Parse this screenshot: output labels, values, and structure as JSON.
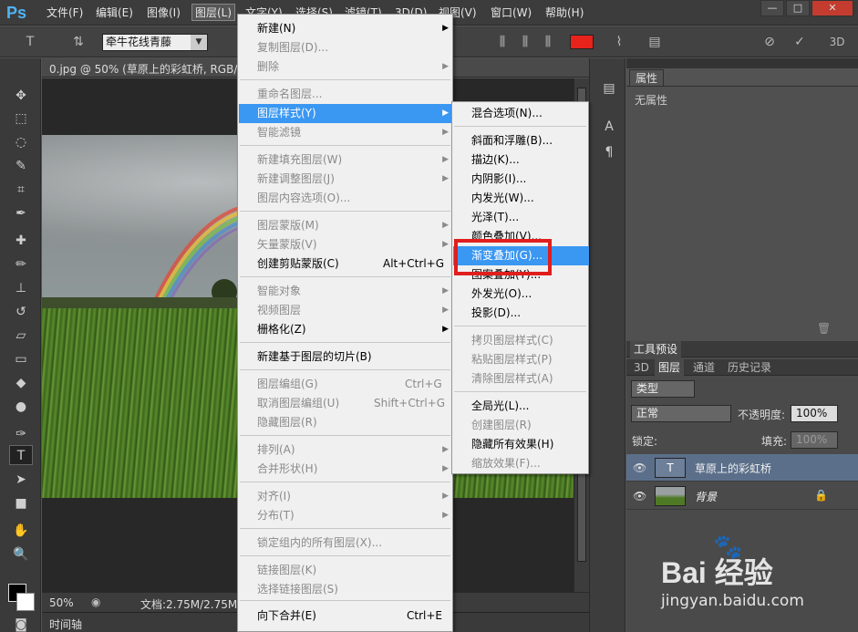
{
  "app": {
    "logo": "Ps"
  },
  "menubar": {
    "items": [
      "文件(F)",
      "编辑(E)",
      "图像(I)",
      "图层(L)",
      "文字(Y)",
      "选择(S)",
      "滤镜(T)",
      "3D(D)",
      "视图(V)",
      "窗口(W)",
      "帮助(H)"
    ],
    "active": "图层(L)"
  },
  "window_controls": {
    "minimize": "—",
    "restore": "□",
    "close": "✕"
  },
  "options": {
    "font_family": "牵牛花线青藤",
    "font_family_dd": "▼",
    "color": "#e8231c",
    "mode_3d": "3D"
  },
  "document": {
    "tab_title": "0.jpg @ 50% (草原上的彩虹桥, RGB/8#)",
    "zoom": "50%",
    "doc_size": "文档:2.75M/2.75M"
  },
  "timeline": {
    "label": "时间轴"
  },
  "properties": {
    "tab": "属性",
    "empty": "无属性"
  },
  "layers_panel": {
    "tabs_top": [
      "工具预设"
    ],
    "tabs": [
      "3D",
      "图层",
      "通道",
      "历史记录"
    ],
    "filter_kind": "类型",
    "blend_mode": "正常",
    "opacity_label": "不透明度:",
    "opacity": "100%",
    "lock_label": "锁定:",
    "fill_label": "填充:",
    "fill": "100%",
    "layers": [
      {
        "name": "草原上的彩虹桥",
        "type": "text",
        "selected": true
      },
      {
        "name": "背景",
        "type": "image",
        "selected": false
      }
    ]
  },
  "layer_menu": {
    "items": [
      {
        "label": "新建(N)",
        "arrow": true
      },
      {
        "label": "复制图层(D)...",
        "dis": true
      },
      {
        "label": "删除",
        "arrow": true,
        "dis": true
      },
      {
        "label": "重命名图层...",
        "dis": true
      },
      {
        "label": "图层样式(Y)",
        "arrow": true,
        "hl": true
      },
      {
        "label": "智能滤镜",
        "arrow": true,
        "dis": true
      },
      {
        "label": "新建填充图层(W)",
        "arrow": true,
        "dis": true
      },
      {
        "label": "新建调整图层(J)",
        "arrow": true,
        "dis": true
      },
      {
        "label": "图层内容选项(O)...",
        "dis": true
      },
      {
        "label": "图层蒙版(M)",
        "arrow": true,
        "dis": true
      },
      {
        "label": "矢量蒙版(V)",
        "arrow": true,
        "dis": true
      },
      {
        "label": "创建剪贴蒙版(C)",
        "shortcut": "Alt+Ctrl+G"
      },
      {
        "label": "智能对象",
        "arrow": true,
        "dis": true
      },
      {
        "label": "视频图层",
        "arrow": true,
        "dis": true
      },
      {
        "label": "栅格化(Z)",
        "arrow": true
      },
      {
        "label": "新建基于图层的切片(B)"
      },
      {
        "label": "图层编组(G)",
        "shortcut": "Ctrl+G",
        "dis": true
      },
      {
        "label": "取消图层编组(U)",
        "shortcut": "Shift+Ctrl+G",
        "dis": true
      },
      {
        "label": "隐藏图层(R)",
        "dis": true
      },
      {
        "label": "排列(A)",
        "arrow": true,
        "dis": true
      },
      {
        "label": "合并形状(H)",
        "arrow": true,
        "dis": true
      },
      {
        "label": "对齐(I)",
        "arrow": true,
        "dis": true
      },
      {
        "label": "分布(T)",
        "arrow": true,
        "dis": true
      },
      {
        "label": "锁定组内的所有图层(X)...",
        "dis": true
      },
      {
        "label": "链接图层(K)",
        "dis": true
      },
      {
        "label": "选择链接图层(S)",
        "dis": true
      },
      {
        "label": "向下合并(E)",
        "shortcut": "Ctrl+E"
      }
    ]
  },
  "style_submenu": {
    "items": [
      {
        "label": "混合选项(N)..."
      },
      {
        "label": "斜面和浮雕(B)..."
      },
      {
        "label": "描边(K)..."
      },
      {
        "label": "内阴影(I)..."
      },
      {
        "label": "内发光(W)..."
      },
      {
        "label": "光泽(T)..."
      },
      {
        "label": "颜色叠加(V)..."
      },
      {
        "label": "渐变叠加(G)...",
        "hl": true
      },
      {
        "label": "图案叠加(Y)..."
      },
      {
        "label": "外发光(O)..."
      },
      {
        "label": "投影(D)..."
      },
      {
        "label": "拷贝图层样式(C)",
        "dis": true
      },
      {
        "label": "粘贴图层样式(P)",
        "dis": true
      },
      {
        "label": "清除图层样式(A)",
        "dis": true
      },
      {
        "label": "全局光(L)..."
      },
      {
        "label": "创建图层(R)",
        "dis": true
      },
      {
        "label": "隐藏所有效果(H)"
      },
      {
        "label": "缩放效果(F)...",
        "dis": true
      }
    ]
  },
  "watermark": {
    "brand": "Bai 经验",
    "url": "jingyan.baidu.com"
  },
  "icons": {
    "arrow": "▶"
  }
}
